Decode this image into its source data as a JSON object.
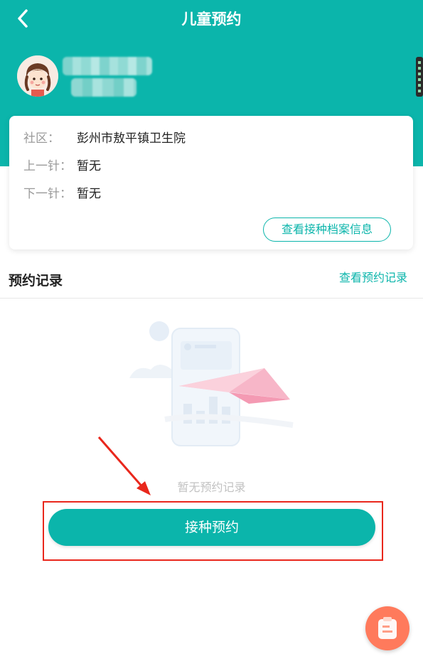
{
  "header": {
    "title": "儿童预约",
    "back_icon": "chevron-left-icon"
  },
  "profile": {
    "avatar_icon": "child-avatar-icon"
  },
  "info_card": {
    "community_label": "社区：",
    "community_value": "彭州市敖平镇卫生院",
    "last_label": "上一针：",
    "last_value": "暂无",
    "next_label": "下一针：",
    "next_value": "暂无",
    "archive_button": "查看接种档案信息"
  },
  "records": {
    "title": "预约记录",
    "link": "查看预约记录",
    "empty_text": "暂无预约记录"
  },
  "actions": {
    "book_button": "接种预约"
  },
  "colors": {
    "accent": "#0bb5ab",
    "highlight": "#e9271c",
    "fab": "#ff7a5c"
  }
}
